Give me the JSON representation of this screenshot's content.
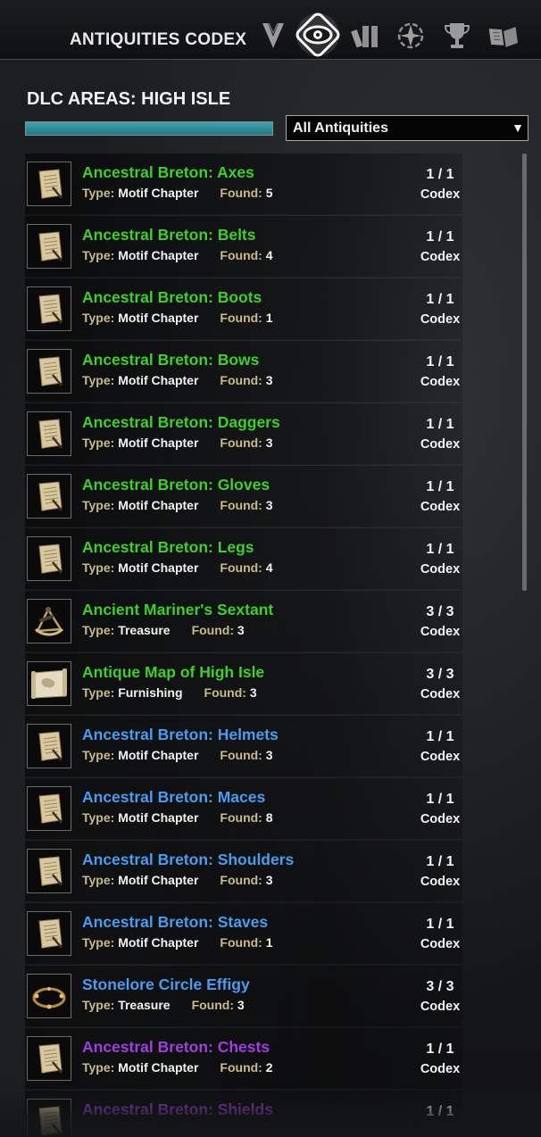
{
  "header": {
    "title": "ANTIQUITIES CODEX",
    "tabs": [
      {
        "icon": "chevron-emblem-icon",
        "active": false
      },
      {
        "icon": "codex-eye-icon",
        "active": true
      },
      {
        "icon": "books-icon",
        "active": false
      },
      {
        "icon": "compass-star-icon",
        "active": false
      },
      {
        "icon": "trophy-icon",
        "active": false
      },
      {
        "icon": "open-book-icon",
        "active": false
      }
    ]
  },
  "section": {
    "title": "DLC AREAS: HIGH ISLE",
    "progress": 1.0,
    "progress_color": "#2f8e98"
  },
  "filter": {
    "selected": "All Antiquities",
    "arrow": "▼"
  },
  "colors": {
    "green": "#3fcf2a",
    "blue": "#4a9cf0",
    "purple": "#a13de0"
  },
  "labels": {
    "type": "Type:",
    "found": "Found:",
    "codex": "Codex"
  },
  "items": [
    {
      "name": "Ancestral Breton: Axes",
      "quality": "green",
      "type": "Motif Chapter",
      "found": "5",
      "count": "1 / 1",
      "icon": "scroll-icon"
    },
    {
      "name": "Ancestral Breton: Belts",
      "quality": "green",
      "type": "Motif Chapter",
      "found": "4",
      "count": "1 / 1",
      "icon": "scroll-icon"
    },
    {
      "name": "Ancestral Breton: Boots",
      "quality": "green",
      "type": "Motif Chapter",
      "found": "1",
      "count": "1 / 1",
      "icon": "scroll-icon"
    },
    {
      "name": "Ancestral Breton: Bows",
      "quality": "green",
      "type": "Motif Chapter",
      "found": "3",
      "count": "1 / 1",
      "icon": "scroll-icon"
    },
    {
      "name": "Ancestral Breton: Daggers",
      "quality": "green",
      "type": "Motif Chapter",
      "found": "3",
      "count": "1 / 1",
      "icon": "scroll-icon"
    },
    {
      "name": "Ancestral Breton: Gloves",
      "quality": "green",
      "type": "Motif Chapter",
      "found": "3",
      "count": "1 / 1",
      "icon": "scroll-icon"
    },
    {
      "name": "Ancestral Breton: Legs",
      "quality": "green",
      "type": "Motif Chapter",
      "found": "4",
      "count": "1 / 1",
      "icon": "scroll-icon"
    },
    {
      "name": "Ancient Mariner's Sextant",
      "quality": "green",
      "type": "Treasure",
      "found": "3",
      "count": "3 / 3",
      "icon": "sextant-icon"
    },
    {
      "name": "Antique Map of High Isle",
      "quality": "green",
      "type": "Furnishing",
      "found": "3",
      "count": "3 / 3",
      "icon": "map-icon"
    },
    {
      "name": "Ancestral Breton: Helmets",
      "quality": "blue",
      "type": "Motif Chapter",
      "found": "3",
      "count": "1 / 1",
      "icon": "scroll-icon"
    },
    {
      "name": "Ancestral Breton: Maces",
      "quality": "blue",
      "type": "Motif Chapter",
      "found": "8",
      "count": "1 / 1",
      "icon": "scroll-icon"
    },
    {
      "name": "Ancestral Breton: Shoulders",
      "quality": "blue",
      "type": "Motif Chapter",
      "found": "3",
      "count": "1 / 1",
      "icon": "scroll-icon"
    },
    {
      "name": "Ancestral Breton: Staves",
      "quality": "blue",
      "type": "Motif Chapter",
      "found": "1",
      "count": "1 / 1",
      "icon": "scroll-icon"
    },
    {
      "name": "Stonelore Circle Effigy",
      "quality": "blue",
      "type": "Treasure",
      "found": "3",
      "count": "3 / 3",
      "icon": "effigy-icon"
    },
    {
      "name": "Ancestral Breton: Chests",
      "quality": "purple",
      "type": "Motif Chapter",
      "found": "2",
      "count": "1 / 1",
      "icon": "scroll-icon"
    },
    {
      "name": "Ancestral Breton: Shields",
      "quality": "purple",
      "type": "",
      "found": "",
      "count": "1 / 1",
      "icon": "scroll-icon"
    }
  ]
}
